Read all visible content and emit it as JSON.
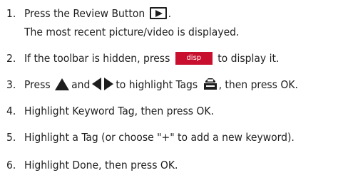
{
  "steps": [
    {
      "num": "1.",
      "pre": "Press the Review Button",
      "post": ".",
      "note": "The most recent picture/video is displayed."
    },
    {
      "num": "2.",
      "pre": "If the toolbar is hidden, press",
      "button": "disp",
      "post": "to display it."
    },
    {
      "num": "3.",
      "pre": "Press",
      "mid1": "and",
      "mid2": "to highlight Tags",
      "post": ", then press OK."
    },
    {
      "num": "4.",
      "text": "Highlight Keyword Tag, then press OK."
    },
    {
      "num": "5.",
      "text": "Highlight a Tag (or choose \"+\" to add a new keyword)."
    },
    {
      "num": "6.",
      "text": "Highlight Done, then press OK."
    }
  ],
  "icons": {
    "review": "play-icon",
    "up": "triangle-up-icon",
    "left": "triangle-left-icon",
    "right": "triangle-right-icon",
    "tags": "tag-icon"
  },
  "colors": {
    "disp_button": "#c8102e",
    "text": "#1e1e1e"
  }
}
